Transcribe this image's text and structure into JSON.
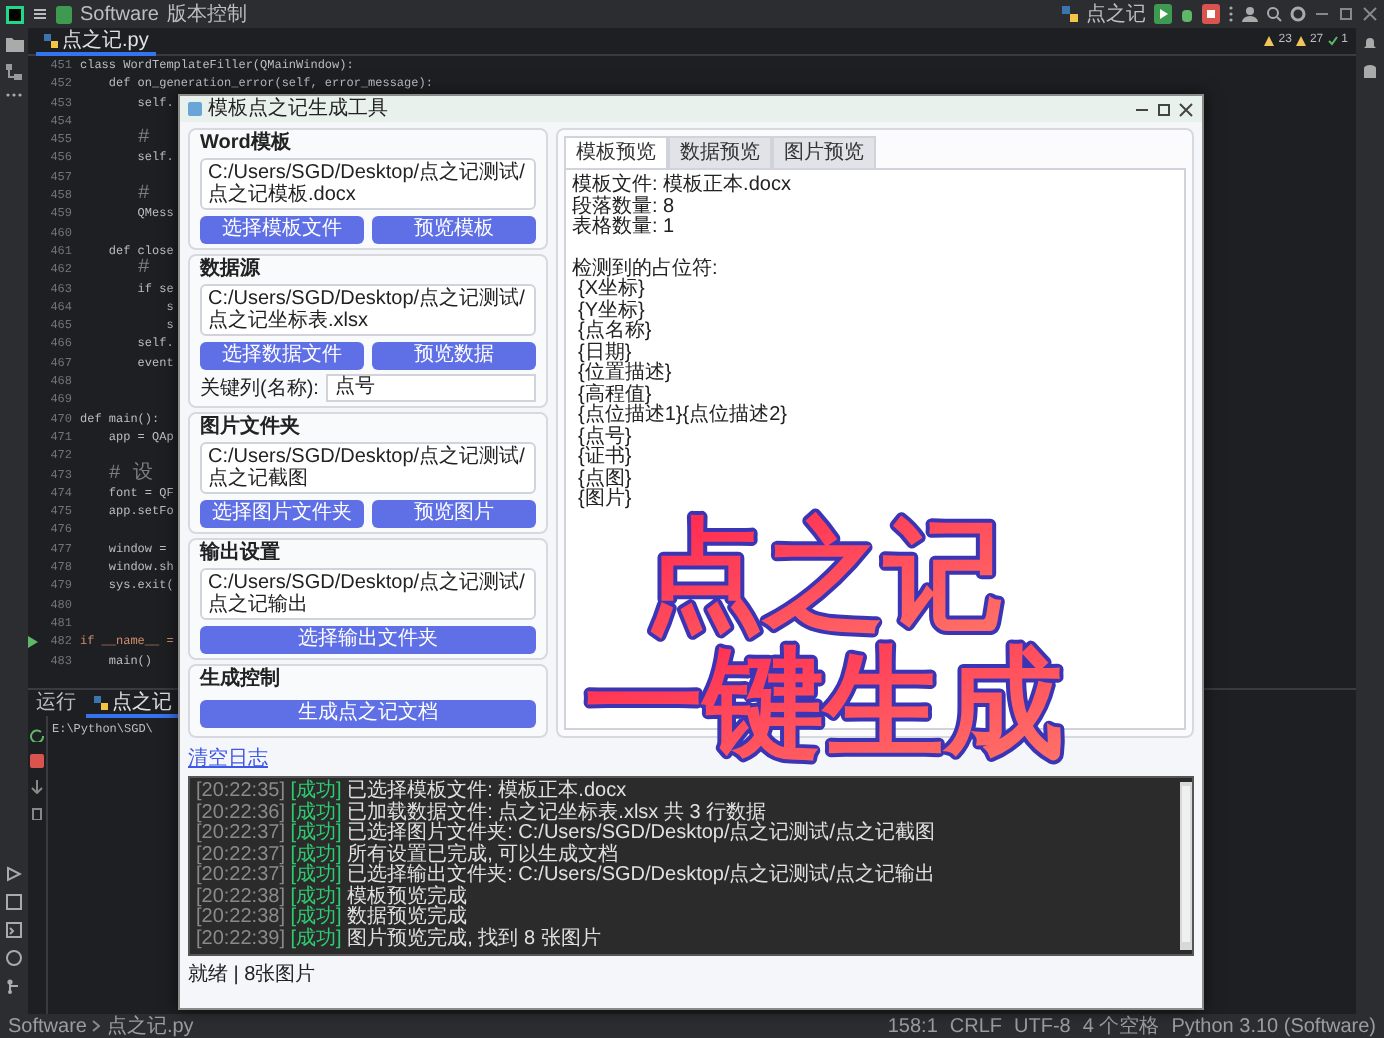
{
  "ide": {
    "toolbar": {
      "project": "Software",
      "vcs": "版本控制",
      "run_config": "点之记"
    },
    "editor_tab": {
      "label": "点之记.py",
      "selected": true
    },
    "inspections": [
      "23",
      "27",
      "1"
    ],
    "code": [
      {
        "number": "451",
        "kind": "code",
        "text": "class WordTemplateFiller(QMainWindow):"
      },
      {
        "number": "452",
        "kind": "code",
        "text": "    def on_generation_error(self, error_message):"
      },
      {
        "number": "453",
        "kind": "code",
        "text": "        self."
      },
      {
        "number": "454",
        "kind": "blank"
      },
      {
        "number": "455",
        "kind": "comment",
        "text": "        #"
      },
      {
        "number": "456",
        "kind": "code",
        "text": "        self."
      },
      {
        "number": "457",
        "kind": "blank"
      },
      {
        "number": "458",
        "kind": "comment",
        "text": "        #"
      },
      {
        "number": "459",
        "kind": "code",
        "text": "        QMess"
      },
      {
        "number": "460",
        "kind": "blank"
      },
      {
        "number": "461",
        "kind": "code",
        "text": "    def close"
      },
      {
        "number": "462",
        "kind": "comment",
        "text": "        #"
      },
      {
        "number": "463",
        "kind": "code",
        "text": "        if se"
      },
      {
        "number": "464",
        "kind": "code",
        "text": "            s"
      },
      {
        "number": "465",
        "kind": "code",
        "text": "            s"
      },
      {
        "number": "466",
        "kind": "code",
        "text": "        self."
      },
      {
        "number": "467",
        "kind": "code",
        "text": "        event"
      },
      {
        "number": "468",
        "kind": "blank"
      },
      {
        "number": "469",
        "kind": "blank"
      },
      {
        "number": "470",
        "kind": "code",
        "text": "def main():"
      },
      {
        "number": "471",
        "kind": "code",
        "text": "    app = QAp"
      },
      {
        "number": "472",
        "kind": "blank"
      },
      {
        "number": "473",
        "kind": "comment",
        "text": "    # 设"
      },
      {
        "number": "474",
        "kind": "code",
        "text": "    font = QF"
      },
      {
        "number": "475",
        "kind": "code",
        "text": "    app.setFo"
      },
      {
        "number": "476",
        "kind": "blank"
      },
      {
        "number": "477",
        "kind": "code",
        "text": "    window ="
      },
      {
        "number": "478",
        "kind": "code",
        "text": "    window.sh"
      },
      {
        "number": "479",
        "kind": "code",
        "text": "    sys.exit("
      },
      {
        "number": "480",
        "kind": "blank"
      },
      {
        "number": "481",
        "kind": "blank"
      },
      {
        "number": "482",
        "kind": "entry",
        "text": "if __name__ ="
      },
      {
        "number": "483",
        "kind": "code",
        "text": "    main()"
      }
    ],
    "run_panel": {
      "title": "运行",
      "tab": "点之记",
      "output": "E:\\Python\\SGD\\"
    },
    "status_bar": {
      "breadcrumb": [
        "Software",
        "点之记.py"
      ],
      "items": [
        "158:1",
        "CRLF",
        "UTF-8",
        "4 个空格",
        "Python 3.10 (Software)"
      ]
    }
  },
  "dialog": {
    "title": "模板点之记生成工具",
    "groups": [
      {
        "title": "Word模板",
        "path": "C:/Users/SGD/Desktop/点之记测试/点之记模板.docx",
        "buttons": [
          "选择模板文件",
          "预览模板"
        ]
      },
      {
        "title": "数据源",
        "path": "C:/Users/SGD/Desktop/点之记测试/点之记坐标表.xlsx",
        "buttons": [
          "选择数据文件",
          "预览数据"
        ],
        "key_field": {
          "label": "关键列(名称):",
          "value": "点号"
        }
      },
      {
        "title": "图片文件夹",
        "path": "C:/Users/SGD/Desktop/点之记测试/点之记截图",
        "buttons": [
          "选择图片文件夹",
          "预览图片"
        ]
      },
      {
        "title": "输出设置",
        "path": "C:/Users/SGD/Desktop/点之记测试/点之记输出",
        "buttons": [
          "选择输出文件夹"
        ]
      },
      {
        "title": "生成控制",
        "buttons": [
          "生成点之记文档"
        ]
      }
    ],
    "tabs": [
      {
        "label": "模板预览",
        "selected": true
      },
      {
        "label": "数据预览",
        "selected": false
      },
      {
        "label": "图片预览",
        "selected": false
      }
    ],
    "summary": [
      "模板文件: 模板正本.docx",
      "段落数量: 8",
      "表格数量: 1"
    ],
    "placeholders": {
      "heading": "检测到的占位符:",
      "items": [
        "{X坐标}",
        "{Y坐标}",
        "{点名称}",
        "{日期}",
        "{位置描述}",
        "{高程值}",
        "{点位描述1}{点位描述2}",
        "{点号}",
        "{证书}",
        "{点图}",
        "{图片}"
      ]
    },
    "clear_log": "清空日志",
    "log": [
      {
        "time": "[20:22:35]",
        "level": "[成功]",
        "kind": "success",
        "message": "已选择模板文件: 模板正本.docx"
      },
      {
        "time": "[20:22:36]",
        "level": "[成功]",
        "kind": "success",
        "message": "已加载数据文件: 点之记坐标表.xlsx 共 3 行数据"
      },
      {
        "time": "[20:22:37]",
        "level": "[成功]",
        "kind": "success",
        "message": "已选择图片文件夹: C:/Users/SGD/Desktop/点之记测试/点之记截图"
      },
      {
        "time": "[20:22:37]",
        "level": "[成功]",
        "kind": "success",
        "message": "所有设置已完成, 可以生成文档"
      },
      {
        "time": "[20:22:37]",
        "level": "[成功]",
        "kind": "success",
        "message": "已选择输出文件夹: C:/Users/SGD/Desktop/点之记测试/点之记输出"
      },
      {
        "time": "[20:22:38]",
        "level": "[成功]",
        "kind": "success",
        "message": "模板预览完成"
      },
      {
        "time": "[20:22:38]",
        "level": "[成功]",
        "kind": "success",
        "message": "数据预览完成"
      },
      {
        "time": "[20:22:39]",
        "level": "[成功]",
        "kind": "success",
        "message": "图片预览完成, 找到 8 张图片"
      }
    ],
    "status": "就绪 | 8张图片"
  },
  "overlay": [
    "点之记",
    "一键生成"
  ]
}
